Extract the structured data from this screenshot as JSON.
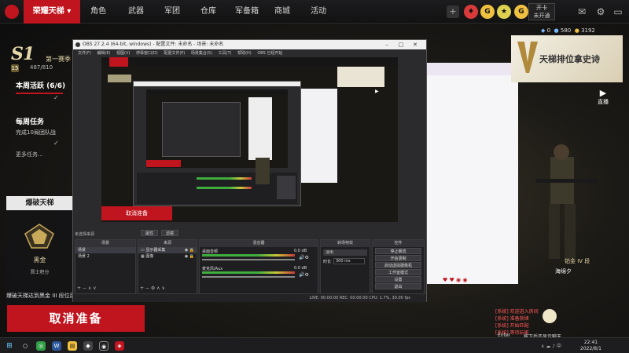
{
  "topnav": {
    "active": "荣耀天梯",
    "items": [
      "角色",
      "武器",
      "军团",
      "仓库",
      "军备箱",
      "商城",
      "活动"
    ]
  },
  "topright": {
    "card_line1": "开卡",
    "card_line2": "未开通",
    "coin_a": "0",
    "coin_b": "580",
    "coin_c": "3192"
  },
  "season": {
    "logo": "S1",
    "label": "第一赛季",
    "level": "15",
    "progress": "487/810"
  },
  "weekly": {
    "title": "本周活跃 (6/6)"
  },
  "daily": {
    "title": "每周任务",
    "desc": "完成10局团队战"
  },
  "more_tasks": "更多任务...",
  "breach": {
    "header": "爆破天梯",
    "rank": "黑金",
    "points": "晋士积分",
    "desc": "爆破天梯达到黑金 III 段位后"
  },
  "cancel_label": "取消准备",
  "promo": {
    "text": "天梯排位拿史诗"
  },
  "live_label": "直播",
  "player": {
    "rank": "铂金 IV 段",
    "name": "海绵夕"
  },
  "chat": {
    "lines": [
      "[系统] 欢迎进入房间",
      "[系统] 准备就绪",
      "[系统] 开始匹配",
      "[系统] 等待玩家"
    ],
    "enter": "Enter",
    "mute": "按下后不显示聊天"
  },
  "obs": {
    "title": "OBS 27.2.4 (64-bit, windows) - 配置文件: 未命名 - 场景: 未命名",
    "menu": [
      "文件(F)",
      "编辑(E)",
      "视图(V)",
      "停靠窗口(D)",
      "配置文件(P)",
      "场景集合(S)",
      "工具(T)",
      "帮助(H)",
      "OBS 已经开始"
    ],
    "preview_label": "取消准备",
    "docks": {
      "scenes_title": "场景",
      "sources_title": "来源",
      "mixer_title": "混音器",
      "transitions_title": "转场特效",
      "controls_title": "控件"
    },
    "scenes": [
      "场景",
      "场景 2"
    ],
    "sources": [
      "显示器采集",
      "图像"
    ],
    "mixer": [
      {
        "name": "桌面音频",
        "level": "0.0 dB"
      },
      {
        "name": "麦克风/Aux",
        "level": "0.0 dB"
      }
    ],
    "transition": {
      "type": "淡出",
      "duration_label": "时长",
      "duration": "300 ms"
    },
    "controls": [
      "停止推流",
      "开始录制",
      "启动虚拟摄像机",
      "工作室模式",
      "设置",
      "退出"
    ],
    "status": "LIVE: 00:00:00   REC: 00:00:00   CPU: 1.7%, 30.00 fps",
    "selected_label": "未选择来源",
    "props_label": "属性",
    "filters_label": "滤镜"
  },
  "taskbar": {
    "time": "22:41",
    "date": "2022/8/1"
  }
}
